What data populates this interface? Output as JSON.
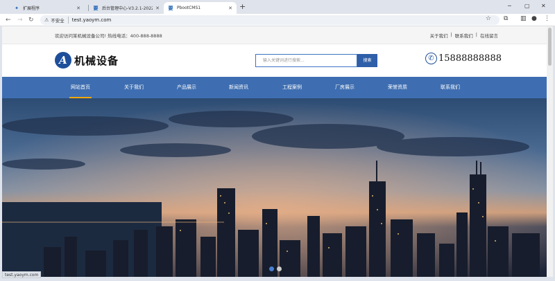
{
  "browser": {
    "tabs": [
      {
        "label": "扩展程序",
        "favicon": "puzzle-icon"
      },
      {
        "label": "后台管理中心-V3.2.1-20220...",
        "favicon": "logo-icon"
      },
      {
        "label": "PbootCMS1",
        "favicon": "logo-icon"
      }
    ],
    "address": {
      "security_label": "不安全",
      "url": "test.yaoym.com"
    },
    "status_url": "test.yaoym.com"
  },
  "site": {
    "topbar": {
      "welcome": "欢迎访问某机械设备公司!  热线电话：400-888-8888",
      "links": [
        "关于我们",
        "联系我们",
        "在线留言"
      ]
    },
    "logo_letter": "A",
    "logo_text": "机械设备",
    "search": {
      "placeholder": "输入关键词进行搜索...",
      "button": "搜索"
    },
    "phone": "15888888888",
    "nav": [
      {
        "label": "网站首页"
      },
      {
        "label": "关于我们"
      },
      {
        "label": "产品展示"
      },
      {
        "label": "新闻资讯"
      },
      {
        "label": "工程案例"
      },
      {
        "label": "厂房展示"
      },
      {
        "label": "荣誉资质"
      },
      {
        "label": "联系我们"
      }
    ],
    "active_nav_index": 0,
    "slider": {
      "count": 2,
      "active": 0
    }
  },
  "colors": {
    "nav_bg": "#3e6eb1",
    "nav_active_underline": "#f2a900",
    "search_button": "#2f5fa8"
  }
}
